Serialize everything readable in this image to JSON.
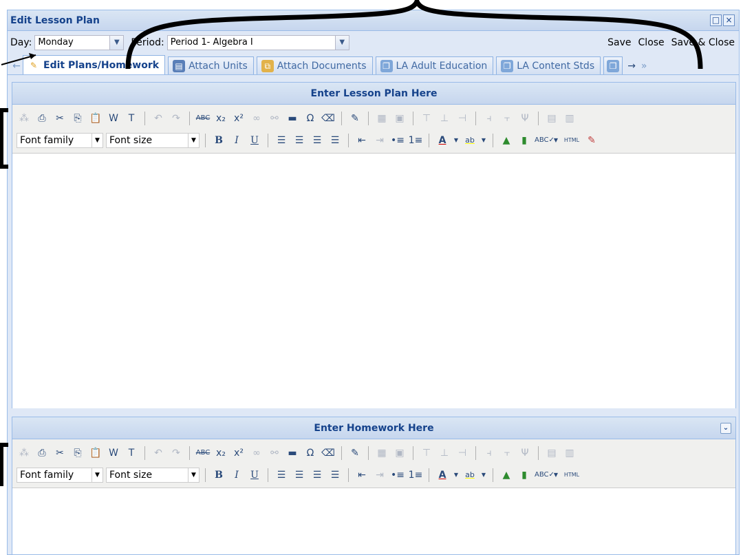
{
  "window": {
    "title": "Edit Lesson Plan",
    "restore_glyph": "□",
    "close_glyph": "×"
  },
  "form": {
    "day_label": "Day:",
    "day_value": "Monday",
    "period_label": "Period:",
    "period_value": "Period 1- Algebra I"
  },
  "actions": [
    "Save",
    "Close",
    "Save & Close"
  ],
  "tabs": [
    {
      "label": "Edit Plans/Homework",
      "icon": "pencil-icon",
      "active": true
    },
    {
      "label": "Attach Units",
      "icon": "unit-icon",
      "active": false
    },
    {
      "label": "Attach Documents",
      "icon": "documents-icon",
      "active": false
    },
    {
      "label": "LA Adult Education",
      "icon": "standards-icon",
      "active": false
    },
    {
      "label": "LA Content Stds",
      "icon": "standards-icon",
      "active": false
    }
  ],
  "panels": {
    "lesson_title": "Enter Lesson Plan Here",
    "homework_title": "Enter Homework Here"
  },
  "toolbar": {
    "font_family": "Font family",
    "font_size": "Font size",
    "html_label": "HTML"
  },
  "colors": {
    "header_blue": "#15428b",
    "panel_border": "#99bbe8",
    "window_bg": "#dfe8f6"
  }
}
